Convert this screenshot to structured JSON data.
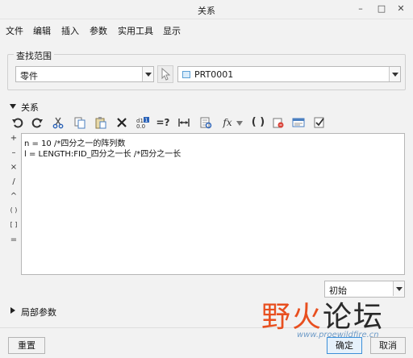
{
  "window": {
    "title": "关系",
    "minimize": "–",
    "maximize": "□",
    "close": "✕"
  },
  "menu": [
    "文件",
    "编辑",
    "插入",
    "参数",
    "实用工具",
    "显示"
  ],
  "lookup": {
    "legend": "查找范围",
    "scope_value": "零件",
    "model_value": "PRT0001"
  },
  "relations": {
    "header": "关系",
    "toolbar_icons": [
      "undo-icon",
      "redo-icon",
      "cut-icon",
      "copy-icon",
      "paste-icon",
      "delete-icon",
      "switch-symbols-icon",
      "evaluate-icon",
      "insert-dimension-icon",
      "pick-from-list-icon",
      "function-icon",
      "parentheses-icon",
      "local-param-icon",
      "sort-relations-icon",
      "verify-icon"
    ],
    "operators": [
      "+",
      "–",
      "×",
      "/",
      "^",
      "( )",
      "[ ]",
      "="
    ],
    "lines": [
      "n = 10 /*四分之一的阵列数",
      "l = LENGTH:FID_四分之一长 /*四分之一长"
    ],
    "init_value": "初始"
  },
  "local_params": {
    "header": "局部参数"
  },
  "buttons": {
    "reset": "重置",
    "ok": "确定",
    "cancel": "取消"
  },
  "watermark": {
    "part1": "野火",
    "part2": "论坛",
    "url": "www.proewildfire.cn"
  }
}
